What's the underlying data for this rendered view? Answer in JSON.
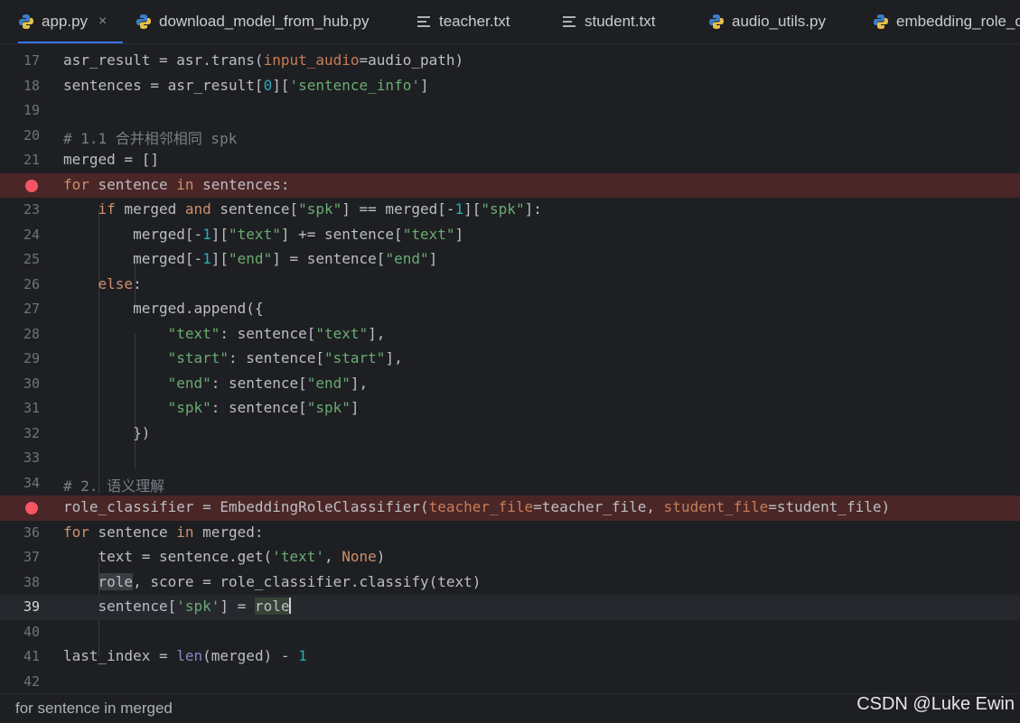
{
  "tabs": [
    {
      "label": "app.py",
      "icon": "python-icon",
      "active": true,
      "close": "×"
    },
    {
      "label": "download_model_from_hub.py",
      "icon": "python-icon"
    },
    {
      "label": "teacher.txt",
      "icon": "text-file-icon"
    },
    {
      "label": "student.txt",
      "icon": "text-file-icon"
    },
    {
      "label": "audio_utils.py",
      "icon": "python-icon"
    },
    {
      "label": "embedding_role_c",
      "icon": "python-icon"
    }
  ],
  "lines": [
    {
      "n": "17",
      "t": "asr_result = asr.trans(input_audio=audio_path)"
    },
    {
      "n": "18",
      "t": "sentences = asr_result[0]['sentence_info']"
    },
    {
      "n": "19",
      "t": ""
    },
    {
      "n": "20",
      "t": "# 1.1 合并相邻相同 spk"
    },
    {
      "n": "21",
      "t": "merged = []"
    },
    {
      "n": "22",
      "t": "for sentence in sentences:",
      "breakpoint": true
    },
    {
      "n": "23",
      "t": "    if merged and sentence[\"spk\"] == merged[-1][\"spk\"]:"
    },
    {
      "n": "24",
      "t": "        merged[-1][\"text\"] += sentence[\"text\"]"
    },
    {
      "n": "25",
      "t": "        merged[-1][\"end\"] = sentence[\"end\"]"
    },
    {
      "n": "26",
      "t": "    else:"
    },
    {
      "n": "27",
      "t": "        merged.append({"
    },
    {
      "n": "28",
      "t": "            \"text\": sentence[\"text\"],"
    },
    {
      "n": "29",
      "t": "            \"start\": sentence[\"start\"],"
    },
    {
      "n": "30",
      "t": "            \"end\": sentence[\"end\"],"
    },
    {
      "n": "31",
      "t": "            \"spk\": sentence[\"spk\"]"
    },
    {
      "n": "32",
      "t": "        })"
    },
    {
      "n": "33",
      "t": ""
    },
    {
      "n": "34",
      "t": "# 2. 语义理解"
    },
    {
      "n": "35",
      "t": "role_classifier = EmbeddingRoleClassifier(teacher_file=teacher_file, student_file=student_file)",
      "breakpoint": true
    },
    {
      "n": "36",
      "t": "for sentence in merged:"
    },
    {
      "n": "37",
      "t": "    text = sentence.get('text', None)"
    },
    {
      "n": "38",
      "t": "    role, score = role_classifier.classify(text)"
    },
    {
      "n": "39",
      "t": "    sentence['spk'] = role",
      "current": true
    },
    {
      "n": "40",
      "t": ""
    },
    {
      "n": "41",
      "t": "last_index = len(merged) - 1"
    },
    {
      "n": "42",
      "t": ""
    }
  ],
  "status": {
    "breadcrumb": "for sentence in merged",
    "watermark": "CSDN @Luke Ewin"
  },
  "colors": {
    "background": "#1e1f22",
    "keyword": "#cf8e6d",
    "string": "#6aab73",
    "number": "#2aacb8",
    "comment": "#7a7e85",
    "breakpoint_line": "#4a2626",
    "breakpoint_dot": "#f75464",
    "tab_underline": "#3574f0"
  }
}
